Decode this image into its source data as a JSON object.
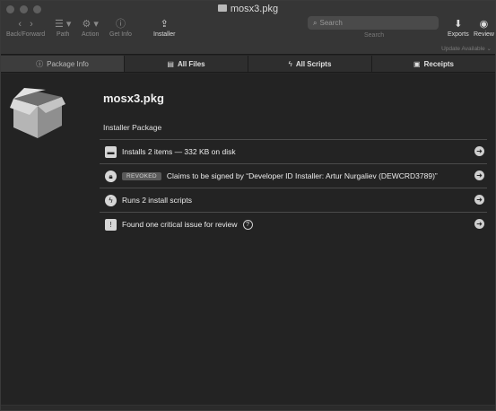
{
  "window": {
    "title": "mosx3.pkg"
  },
  "toolbar": {
    "back_forward": "Back/Forward",
    "path": "Path",
    "action": "Action",
    "get_info": "Get Info",
    "installer": "Installer",
    "search_placeholder": "Search",
    "search_label": "Search",
    "exports": "Exports",
    "review": "Review",
    "update": "Update Available"
  },
  "tabs": [
    {
      "label": "Package Info",
      "icon": "info-icon"
    },
    {
      "label": "All Files",
      "icon": "files-icon"
    },
    {
      "label": "All Scripts",
      "icon": "scripts-icon"
    },
    {
      "label": "Receipts",
      "icon": "receipts-icon"
    }
  ],
  "package": {
    "name": "mosx3.pkg",
    "type": "Installer Package"
  },
  "rows": [
    {
      "text": "Installs 2 items — 332 KB on disk",
      "icon": "disk-icon"
    },
    {
      "badge": "REVOKED",
      "text": "Claims to be signed by “Developer ID Installer: Artur Nurgaliev (DEWCRD3789)”",
      "icon": "lock-icon"
    },
    {
      "text": "Runs 2 install scripts",
      "icon": "lightning-icon"
    },
    {
      "text": "Found one critical issue for review",
      "icon": "warning-icon"
    }
  ]
}
